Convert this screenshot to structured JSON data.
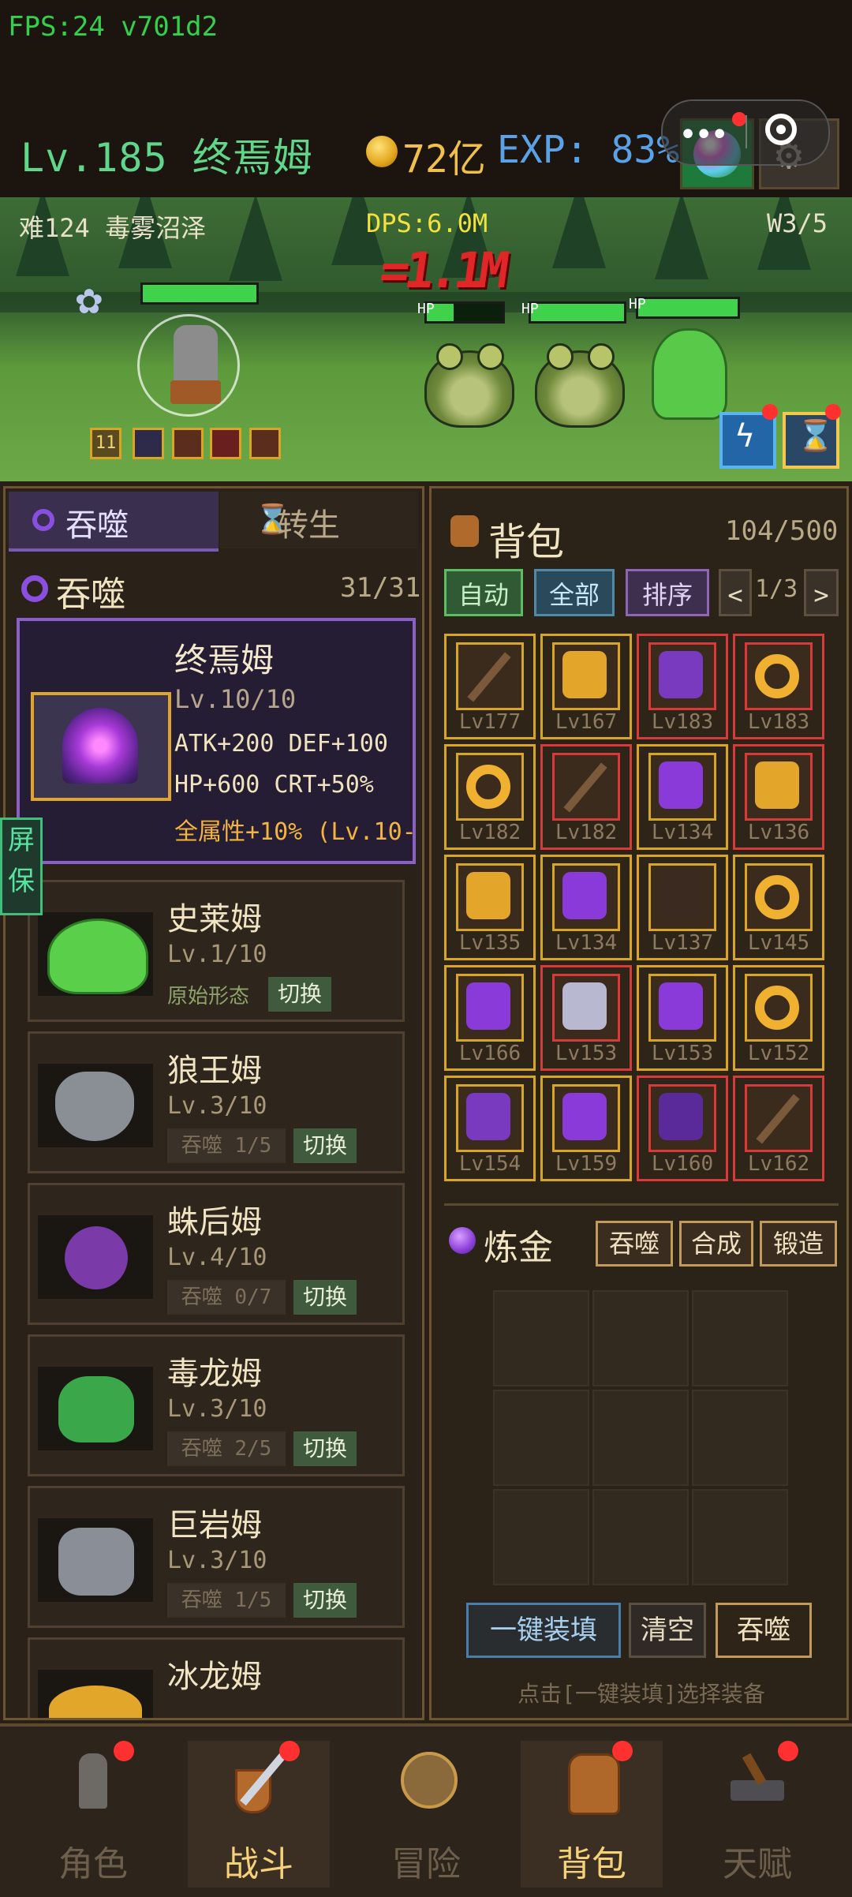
{
  "top": {
    "fps": "FPS:24 v701d2",
    "level_name": "Lv.185 终焉姆",
    "gold": "72亿",
    "exp": "EXP: 83%"
  },
  "battle": {
    "stage": "难124 毒雾沼泽",
    "dps": "DPS:6.0M",
    "wave": "W3/5",
    "damage_text": "=1.1M",
    "hp_label": "HP",
    "skill_slot_level": "11"
  },
  "left": {
    "tab_devour": "吞噬",
    "tab_rebirth": "转生",
    "section_title": "吞噬",
    "section_count": "31/31",
    "featured": {
      "name": "终焉姆",
      "level": "Lv.10/10",
      "stat1": "ATK+200 DEF+100",
      "stat2": "HP+600 CRT+50%",
      "stat3": "全属性+10% (Lv.10-"
    },
    "cards": [
      {
        "name": "史莱姆",
        "level": "Lv.1/10",
        "state": "原始形态",
        "switch": "切换"
      },
      {
        "name": "狼王姆",
        "level": "Lv.3/10",
        "progress": "吞噬 1/5",
        "switch": "切换"
      },
      {
        "name": "蛛后姆",
        "level": "Lv.4/10",
        "progress": "吞噬 0/7",
        "switch": "切换"
      },
      {
        "name": "毒龙姆",
        "level": "Lv.3/10",
        "progress": "吞噬 2/5",
        "switch": "切换"
      },
      {
        "name": "巨岩姆",
        "level": "Lv.3/10",
        "progress": "吞噬 1/5",
        "switch": "切换"
      },
      {
        "name": "冰龙姆",
        "level": "",
        "progress": "",
        "switch": ""
      }
    ],
    "screensaver": "屏保"
  },
  "bag": {
    "title": "背包",
    "count": "104/500",
    "btn_auto": "自动",
    "btn_all": "全部",
    "btn_sort": "排序",
    "prev": "<",
    "page": "1/3",
    "next": ">",
    "items": [
      {
        "lv": "Lv177",
        "icon": "staff-icon",
        "rarity": "gold"
      },
      {
        "lv": "Lv167",
        "icon": "armor-icon",
        "rarity": "gold"
      },
      {
        "lv": "Lv183",
        "icon": "pants-icon",
        "rarity": "red"
      },
      {
        "lv": "Lv183",
        "icon": "ring-icon",
        "rarity": "red"
      },
      {
        "lv": "Lv182",
        "icon": "ring-icon",
        "rarity": "gold"
      },
      {
        "lv": "Lv182",
        "icon": "staff-icon",
        "rarity": "red"
      },
      {
        "lv": "Lv134",
        "icon": "glove-icon",
        "rarity": "gold"
      },
      {
        "lv": "Lv136",
        "icon": "armor-icon",
        "rarity": "red"
      },
      {
        "lv": "Lv135",
        "icon": "armor-icon",
        "rarity": "gold"
      },
      {
        "lv": "Lv134",
        "icon": "amulet-icon",
        "rarity": "gold"
      },
      {
        "lv": "Lv137",
        "icon": "helmet-icon",
        "rarity": "gold"
      },
      {
        "lv": "Lv145",
        "icon": "ring-icon",
        "rarity": "gold"
      },
      {
        "lv": "Lv166",
        "icon": "amulet-icon",
        "rarity": "gold"
      },
      {
        "lv": "Lv153",
        "icon": "boots-icon",
        "rarity": "red"
      },
      {
        "lv": "Lv153",
        "icon": "glove-icon",
        "rarity": "gold"
      },
      {
        "lv": "Lv152",
        "icon": "ring-icon",
        "rarity": "gold"
      },
      {
        "lv": "Lv154",
        "icon": "pants-icon",
        "rarity": "gold"
      },
      {
        "lv": "Lv159",
        "icon": "glove-icon",
        "rarity": "gold"
      },
      {
        "lv": "Lv160",
        "icon": "robe-icon",
        "rarity": "red"
      },
      {
        "lv": "Lv162",
        "icon": "staff-icon",
        "rarity": "red"
      }
    ]
  },
  "alchemy": {
    "title": "炼金",
    "btn_devour": "吞噬",
    "btn_combine": "合成",
    "btn_forge": "锻造",
    "btn_fill": "一键装填",
    "btn_clear": "清空",
    "btn_devour2": "吞噬",
    "hint": "点击[一键装填]选择装备"
  },
  "nav": {
    "items": [
      {
        "label": "角色",
        "icon": "knight-icon"
      },
      {
        "label": "战斗",
        "icon": "sword-shield-icon"
      },
      {
        "label": "冒险",
        "icon": "compass-icon"
      },
      {
        "label": "背包",
        "icon": "backpack-icon"
      },
      {
        "label": "天赋",
        "icon": "anvil-icon"
      }
    ]
  },
  "colors": {
    "gold_border": "#d9a623",
    "red_border": "#d83a3a",
    "accent_green": "#3fd24a"
  }
}
